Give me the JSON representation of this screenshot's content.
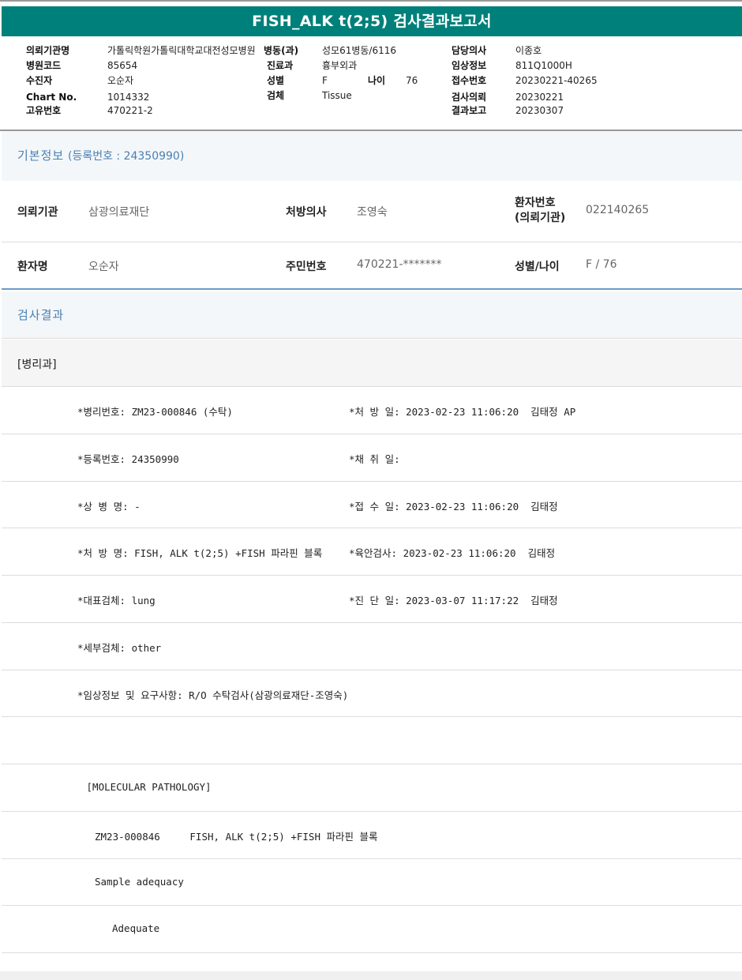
{
  "title": "FISH_ALK t(2;5) 검사결과보고서",
  "header": {
    "inst_label": "의뢰기관명",
    "inst": "가톨릭학원가톨릭대학교대전성모병원",
    "ward_label": "병동(과)",
    "ward": "성모61병동/6116",
    "doctor_label": "담당의사",
    "doctor": "이종호",
    "code_label": "병원코드",
    "code": "85654",
    "dept_label": "진료과",
    "dept": "흉부외과",
    "clinical_label": "임상정보",
    "clinical": "811Q1000H",
    "recv_label": "수진자",
    "recv": "오순자",
    "sex_label": "성별",
    "sex": "F",
    "age_label": "나이",
    "age": "76",
    "accession_label": "접수번호",
    "accession": "20230221-40265",
    "chart_label": "Chart No.",
    "chart": "1014332",
    "specimen_label": "검체",
    "specimen": "Tissue",
    "request_label": "검사의뢰",
    "request": "20230221",
    "uid_label": "고유번호",
    "uid": "470221-2",
    "report_label": "결과보고",
    "report": "20230307"
  },
  "basic": {
    "title": "기본정보",
    "reg": "(등록번호 : 24350990)",
    "inst_label": "의뢰기관",
    "inst": "삼광의료재단",
    "presc_label": "처방의사",
    "presc": "조영숙",
    "pid_label": "환자번호",
    "pid_label2": "(의뢰기관)",
    "pid": "022140265",
    "name_label": "환자명",
    "name": "오순자",
    "rrn_label": "주민번호",
    "rrn": "470221-*******",
    "sexage_label": "성별/나이",
    "sexage": "F / 76"
  },
  "result": {
    "title": "검사결과",
    "dept": "[병리과]",
    "left": [
      "*병리번호: ZM23-000846 (수탁)",
      "*등록번호: 24350990",
      "*상 병 명: -",
      "*처 방 명: FISH, ALK t(2;5) +FISH 파라핀 블록",
      "*대표검체: lung",
      "*세부검체: other",
      "*임상정보 및 요구사항: R/O 수탁검사(삼광의료재단-조영숙)"
    ],
    "right": [
      "*처 방 일: 2023-02-23 11:06:20  김태정 AP",
      "*채 취 일:",
      "*접 수 일: 2023-02-23 11:06:20  김태정",
      "*육안검사: 2023-02-23 11:06:20  김태정",
      "*진 단 일: 2023-03-07 11:17:22  김태정"
    ],
    "mol": " [MOLECULAR PATHOLOGY]",
    "mol_line": "ZM23-000846     FISH, ALK t(2;5) +FISH 파라핀 블록",
    "adequacy": "Sample adequacy",
    "adequate": "Adequate"
  }
}
